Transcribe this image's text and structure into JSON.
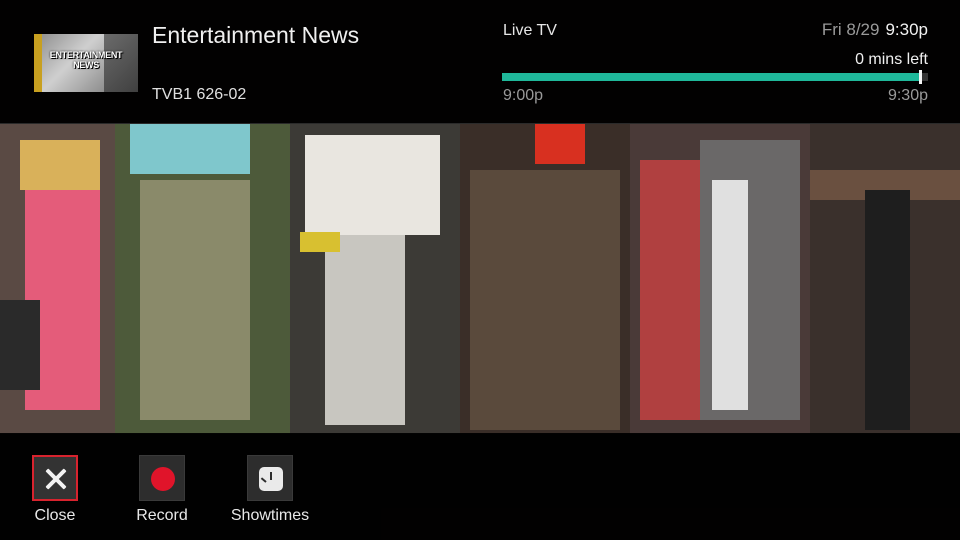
{
  "header": {
    "thumbnail_text": "ENTERTAINMENT NEWS",
    "program_title": "Entertainment News",
    "channel": "TVB1 626-02",
    "mode_label": "Live TV",
    "date": "Fri 8/29",
    "current_time": "9:30p",
    "remaining": "0 mins left",
    "start_time": "9:00p",
    "end_time": "9:30p",
    "progress_percent": 98,
    "accent_color": "#1fb89a"
  },
  "actions": [
    {
      "label": "Close",
      "icon": "close-icon",
      "focused": true
    },
    {
      "label": "Record",
      "icon": "record-icon",
      "focused": false
    },
    {
      "label": "Showtimes",
      "icon": "clock-icon",
      "focused": false
    }
  ],
  "colors": {
    "focus_border": "#d8232e",
    "record_red": "#e0142a"
  }
}
